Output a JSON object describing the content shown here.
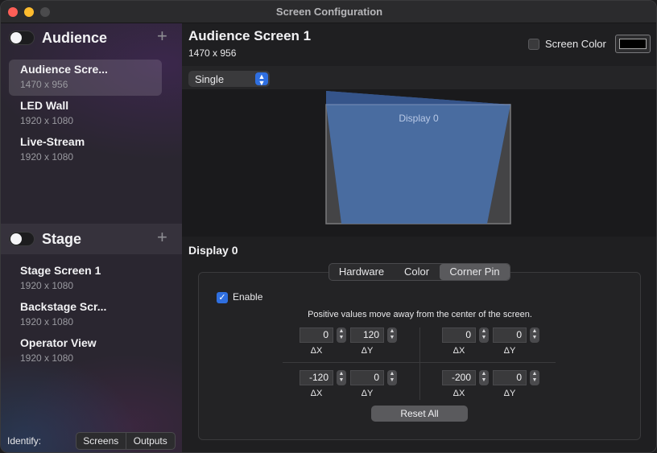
{
  "window": {
    "title": "Screen Configuration"
  },
  "sidebar": {
    "sections": [
      {
        "title": "Audience",
        "enabled": false,
        "items": [
          {
            "name": "Audience Scre...",
            "resolution": "1470 x 956",
            "selected": true
          },
          {
            "name": "LED Wall",
            "resolution": "1920 x 1080"
          },
          {
            "name": "Live-Stream",
            "resolution": "1920 x 1080"
          }
        ]
      },
      {
        "title": "Stage",
        "enabled": false,
        "items": [
          {
            "name": "Stage Screen 1",
            "resolution": "1920 x 1080"
          },
          {
            "name": "Backstage Scr...",
            "resolution": "1920 x 1080"
          },
          {
            "name": "Operator View",
            "resolution": "1920 x 1080"
          }
        ]
      }
    ],
    "identify": {
      "label": "Identify:",
      "buttons": [
        "Screens",
        "Outputs"
      ]
    }
  },
  "header": {
    "title": "Audience Screen 1",
    "resolution": "1470 x 956",
    "screen_color_label": "Screen Color",
    "screen_color_checked": false,
    "screen_color_value": "#000000"
  },
  "mode_select": {
    "value": "Single"
  },
  "preview": {
    "display_label": "Display 0",
    "fill_color": "#4a6fa5"
  },
  "display": {
    "heading": "Display 0",
    "tabs": [
      "Hardware",
      "Color",
      "Corner Pin"
    ],
    "active_tab": "Corner Pin",
    "enable_label": "Enable",
    "enable_checked": true,
    "hint": "Positive values move away from the center of the screen.",
    "corners": {
      "top_left": {
        "dx": "0",
        "dy": "120"
      },
      "top_right": {
        "dx": "0",
        "dy": "0"
      },
      "bottom_left": {
        "dx": "-120",
        "dy": "0"
      },
      "bottom_right": {
        "dx": "-200",
        "dy": "0"
      }
    },
    "dx_label": "ΔX",
    "dy_label": "ΔY",
    "reset_label": "Reset All"
  },
  "colors": {
    "accent": "#2f6fe0",
    "preview_fill": "#4a6fa5"
  }
}
